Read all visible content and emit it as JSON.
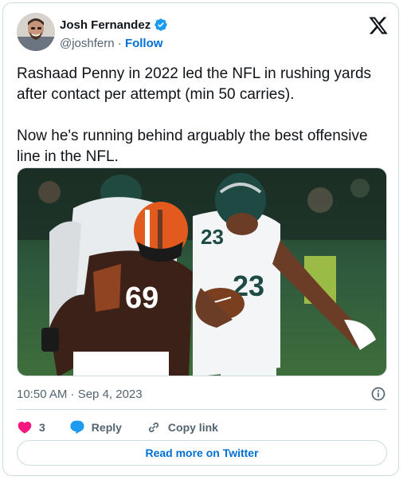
{
  "author": {
    "display_name": "Josh Fernandez",
    "handle": "@joshfern",
    "separator": "·",
    "follow_label": "Follow",
    "verified_color": "#1d9bf0"
  },
  "tweet": {
    "text": "Rashaad Penny in 2022 led the NFL in rushing yards after contact per attempt (min 50 carries).\n\nNow he's running behind arguably the best offensive line in the NFL.",
    "timestamp": "10:50 AM · Sep 4, 2023"
  },
  "media": {
    "description_icon": "football-photo",
    "left_player_jersey": "69",
    "right_player_jersey": "23"
  },
  "actions": {
    "like_count": "3",
    "reply_label": "Reply",
    "copy_link_label": "Copy link"
  },
  "footer": {
    "read_more_label": "Read more on Twitter"
  },
  "colors": {
    "accent": "#006fd6",
    "like": "#f91880",
    "reply": "#1d9bf0",
    "text_secondary": "#536471",
    "border": "#cfd9de"
  }
}
